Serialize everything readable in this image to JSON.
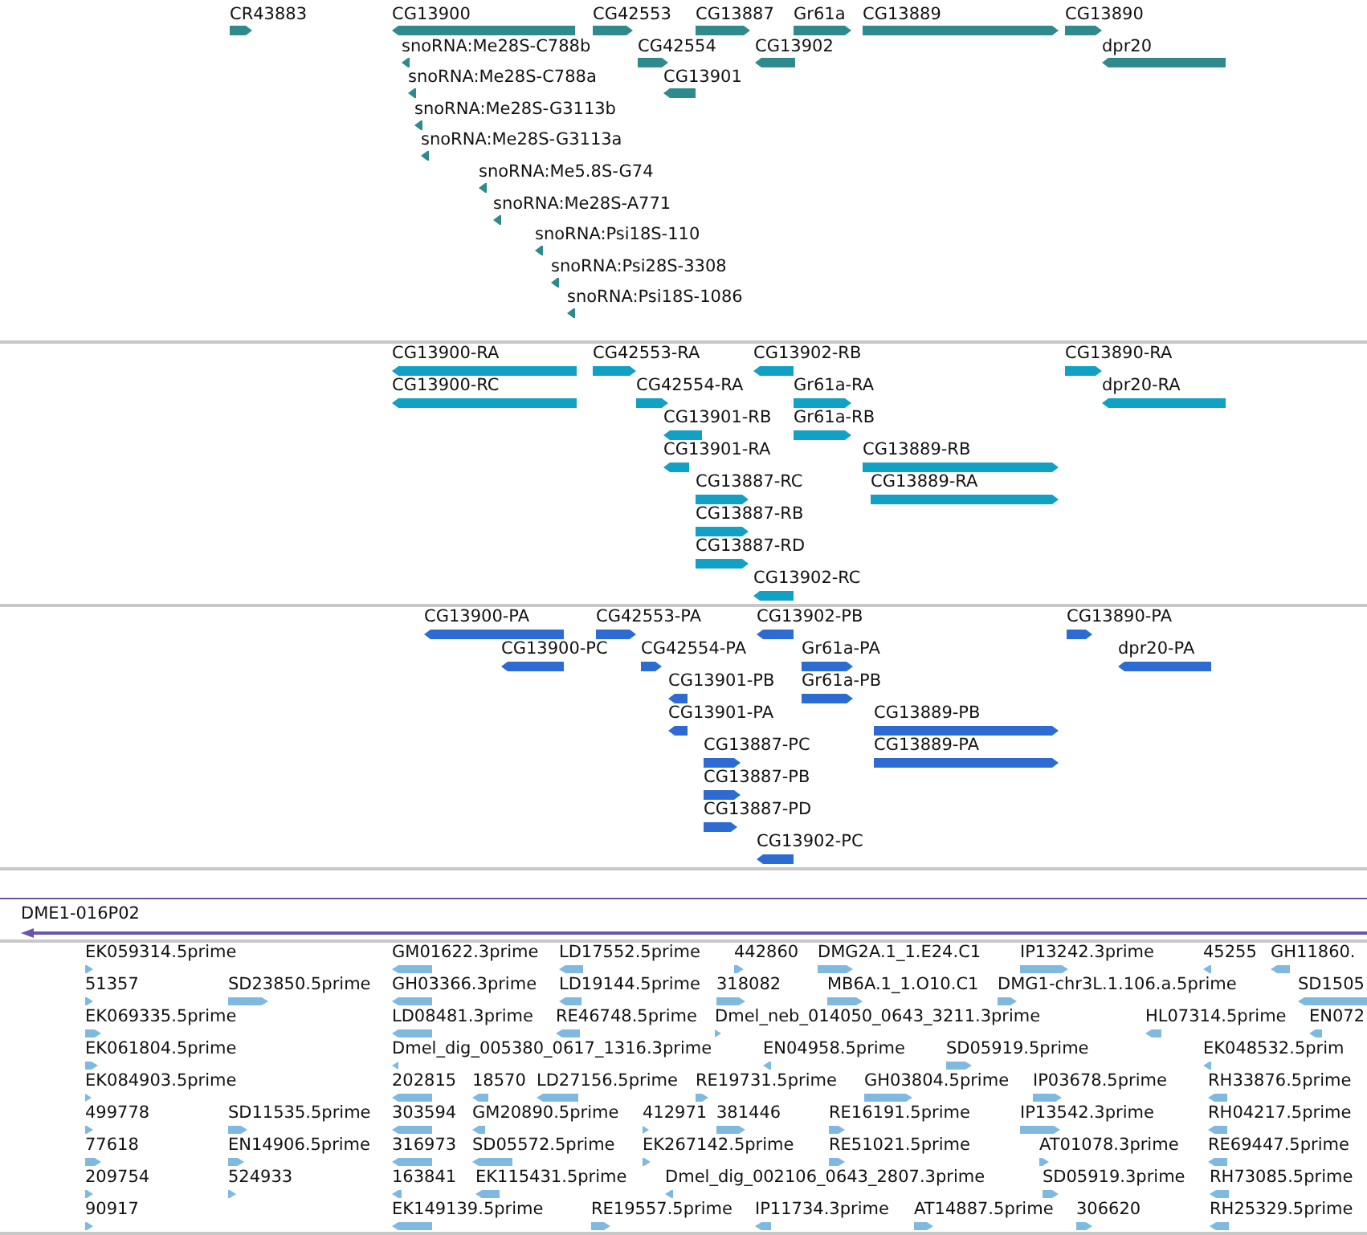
{
  "tracks": [
    {
      "kind": "gene",
      "features": [
        {
          "label": "CR43883",
          "reverse": false
        },
        {
          "label": "CG13900",
          "reverse": true
        },
        {
          "label": "CG42553",
          "reverse": false
        },
        {
          "label": "CG13887",
          "reverse": false
        },
        {
          "label": "Gr61a",
          "reverse": false
        },
        {
          "label": "CG13889",
          "reverse": false
        },
        {
          "label": "CG13890",
          "reverse": false
        },
        {
          "label": "snoRNA:Me28S-C788b",
          "reverse": true
        },
        {
          "label": "CG42554",
          "reverse": false
        },
        {
          "label": "CG13902",
          "reverse": true
        },
        {
          "label": "dpr20",
          "reverse": true
        },
        {
          "label": "snoRNA:Me28S-C788a",
          "reverse": true
        },
        {
          "label": "CG13901",
          "reverse": true
        },
        {
          "label": "snoRNA:Me28S-G3113b",
          "reverse": true
        },
        {
          "label": "snoRNA:Me28S-G3113a",
          "reverse": true
        },
        {
          "label": "snoRNA:Me5.8S-G74",
          "reverse": true
        },
        {
          "label": "snoRNA:Me28S-A771",
          "reverse": true
        },
        {
          "label": "snoRNA:Psi18S-110",
          "reverse": true
        },
        {
          "label": "snoRNA:Psi28S-3308",
          "reverse": true
        },
        {
          "label": "snoRNA:Psi18S-1086",
          "reverse": true
        }
      ]
    },
    {
      "kind": "transcript",
      "features": [
        {
          "label": "CG13900-RA",
          "reverse": true
        },
        {
          "label": "CG42553-RA",
          "reverse": false
        },
        {
          "label": "CG13902-RB",
          "reverse": true
        },
        {
          "label": "CG13890-RA",
          "reverse": false
        },
        {
          "label": "CG13900-RC",
          "reverse": true
        },
        {
          "label": "CG42554-RA",
          "reverse": false
        },
        {
          "label": "Gr61a-RA",
          "reverse": false
        },
        {
          "label": "dpr20-RA",
          "reverse": true
        },
        {
          "label": "CG13901-RB",
          "reverse": true
        },
        {
          "label": "Gr61a-RB",
          "reverse": false
        },
        {
          "label": "CG13901-RA",
          "reverse": true
        },
        {
          "label": "CG13889-RB",
          "reverse": false
        },
        {
          "label": "CG13887-RC",
          "reverse": false
        },
        {
          "label": "CG13889-RA",
          "reverse": false
        },
        {
          "label": "CG13887-RB",
          "reverse": false
        },
        {
          "label": "CG13887-RD",
          "reverse": false
        },
        {
          "label": "CG13902-RC",
          "reverse": true
        }
      ]
    },
    {
      "kind": "protein",
      "features": [
        {
          "label": "CG13900-PA",
          "reverse": true
        },
        {
          "label": "CG42553-PA",
          "reverse": false
        },
        {
          "label": "CG13902-PB",
          "reverse": true
        },
        {
          "label": "CG13890-PA",
          "reverse": false
        },
        {
          "label": "CG13900-PC",
          "reverse": true
        },
        {
          "label": "CG42554-PA",
          "reverse": false
        },
        {
          "label": "Gr61a-PA",
          "reverse": false
        },
        {
          "label": "dpr20-PA",
          "reverse": true
        },
        {
          "label": "CG13901-PB",
          "reverse": true
        },
        {
          "label": "Gr61a-PB",
          "reverse": false
        },
        {
          "label": "CG13901-PA",
          "reverse": true
        },
        {
          "label": "CG13889-PB",
          "reverse": false
        },
        {
          "label": "CG13887-PC",
          "reverse": false
        },
        {
          "label": "CG13889-PA",
          "reverse": false
        },
        {
          "label": "CG13887-PB",
          "reverse": false
        },
        {
          "label": "CG13887-PD",
          "reverse": false
        },
        {
          "label": "CG13902-PC",
          "reverse": true
        }
      ]
    },
    {
      "kind": "clone",
      "features": [
        {
          "label": "DME1-016P02",
          "reverse": true
        }
      ]
    },
    {
      "kind": "est",
      "features": [
        {
          "label": "EK059314.5prime",
          "reverse": false
        },
        {
          "label": "GM01622.3prime",
          "reverse": true
        },
        {
          "label": "LD17552.5prime",
          "reverse": true
        },
        {
          "label": "442860",
          "reverse": false
        },
        {
          "label": "DMG2A.1_1.E24.C1",
          "reverse": false
        },
        {
          "label": "IP13242.3prime",
          "reverse": false
        },
        {
          "label": "45255",
          "reverse": true
        },
        {
          "label": "GH11860.",
          "reverse": true
        },
        {
          "label": "51357",
          "reverse": false
        },
        {
          "label": "SD23850.5prime",
          "reverse": false
        },
        {
          "label": "GH03366.3prime",
          "reverse": true
        },
        {
          "label": "LD19144.5prime",
          "reverse": true
        },
        {
          "label": "318082",
          "reverse": false
        },
        {
          "label": "MB6A.1_1.O10.C1",
          "reverse": false
        },
        {
          "label": "DMG1-chr3L.1.106.a.5prime",
          "reverse": false
        },
        {
          "label": "SD1505",
          "reverse": true
        },
        {
          "label": "EK069335.5prime",
          "reverse": false
        },
        {
          "label": "LD08481.3prime",
          "reverse": true
        },
        {
          "label": "RE46748.5prime",
          "reverse": true
        },
        {
          "label": "Dmel_neb_014050_0643_3211.3prime",
          "reverse": false
        },
        {
          "label": "HL07314.5prime",
          "reverse": true
        },
        {
          "label": "EN072",
          "reverse": true
        },
        {
          "label": "EK061804.5prime",
          "reverse": false
        },
        {
          "label": "Dmel_dig_005380_0617_1316.3prime",
          "reverse": true
        },
        {
          "label": "EN04958.5prime",
          "reverse": true
        },
        {
          "label": "SD05919.5prime",
          "reverse": false
        },
        {
          "label": "EK048532.5prim",
          "reverse": true
        },
        {
          "label": "EK084903.5prime",
          "reverse": false
        },
        {
          "label": "202815",
          "reverse": true
        },
        {
          "label": "18570",
          "reverse": true
        },
        {
          "label": "LD27156.5prime",
          "reverse": true
        },
        {
          "label": "RE19731.5prime",
          "reverse": false
        },
        {
          "label": "GH03804.5prime",
          "reverse": false
        },
        {
          "label": "IP03678.5prime",
          "reverse": false
        },
        {
          "label": "RH33876.5prime",
          "reverse": true
        },
        {
          "label": "499778",
          "reverse": false
        },
        {
          "label": "SD11535.5prime",
          "reverse": false
        },
        {
          "label": "303594",
          "reverse": true
        },
        {
          "label": "GM20890.5prime",
          "reverse": true
        },
        {
          "label": "412971",
          "reverse": false
        },
        {
          "label": "381446",
          "reverse": false
        },
        {
          "label": "RE16191.5prime",
          "reverse": false
        },
        {
          "label": "IP13542.3prime",
          "reverse": false
        },
        {
          "label": "RH04217.5prime",
          "reverse": true
        },
        {
          "label": "77618",
          "reverse": false
        },
        {
          "label": "EN14906.5prime",
          "reverse": false
        },
        {
          "label": "316973",
          "reverse": true
        },
        {
          "label": "SD05572.5prime",
          "reverse": true
        },
        {
          "label": "EK267142.5prime",
          "reverse": false
        },
        {
          "label": "RE51021.5prime",
          "reverse": false
        },
        {
          "label": "AT01078.3prime",
          "reverse": false
        },
        {
          "label": "RE69447.5prime",
          "reverse": true
        },
        {
          "label": "209754",
          "reverse": false
        },
        {
          "label": "524933",
          "reverse": false
        },
        {
          "label": "163841",
          "reverse": true
        },
        {
          "label": "EK115431.5prime",
          "reverse": true
        },
        {
          "label": "Dmel_dig_002106_0643_2807.3prime",
          "reverse": true
        },
        {
          "label": "SD05919.3prime",
          "reverse": false
        },
        {
          "label": "RH73085.5prime",
          "reverse": true
        },
        {
          "label": "90917",
          "reverse": false
        },
        {
          "label": "EK149139.5prime",
          "reverse": true
        },
        {
          "label": "RE19557.5prime",
          "reverse": false
        },
        {
          "label": "IP11734.3prime",
          "reverse": true
        },
        {
          "label": "AT14887.5prime",
          "reverse": false
        },
        {
          "label": "306620",
          "reverse": false
        },
        {
          "label": "RH25329.5prime",
          "reverse": true
        }
      ]
    }
  ]
}
